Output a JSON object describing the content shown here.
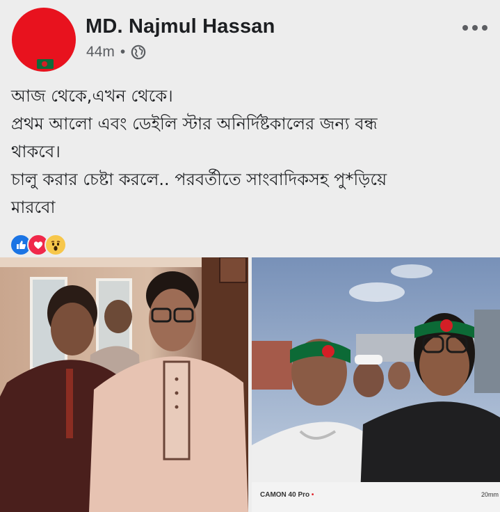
{
  "post": {
    "author": "MD. Najmul Hassan",
    "time": "44m",
    "separator": "•",
    "body_lines": [
      "আজ থেকে,এখন থেকে।",
      "প্রথম আলো এবং ডেইলি স্টার অনির্দিষ্টকালের জন্য বন্ধ",
      "থাকবে।",
      "চালু করার চেষ্টা করলে.. পরবর্তীতে সাংবাদিকসহ পু*ড়িয়ে",
      "মারবো"
    ],
    "reactions": [
      "like-icon",
      "love-icon",
      "wow-icon"
    ]
  },
  "photo_watermark": {
    "model": "CAMON 40 Pro",
    "dot": "•",
    "focal": "20mm"
  },
  "colors": {
    "background": "#ededed",
    "avatar_red": "#e8121e",
    "like_blue": "#1b74e4",
    "love_red": "#f0284a",
    "wow_yellow": "#f7c74b"
  }
}
